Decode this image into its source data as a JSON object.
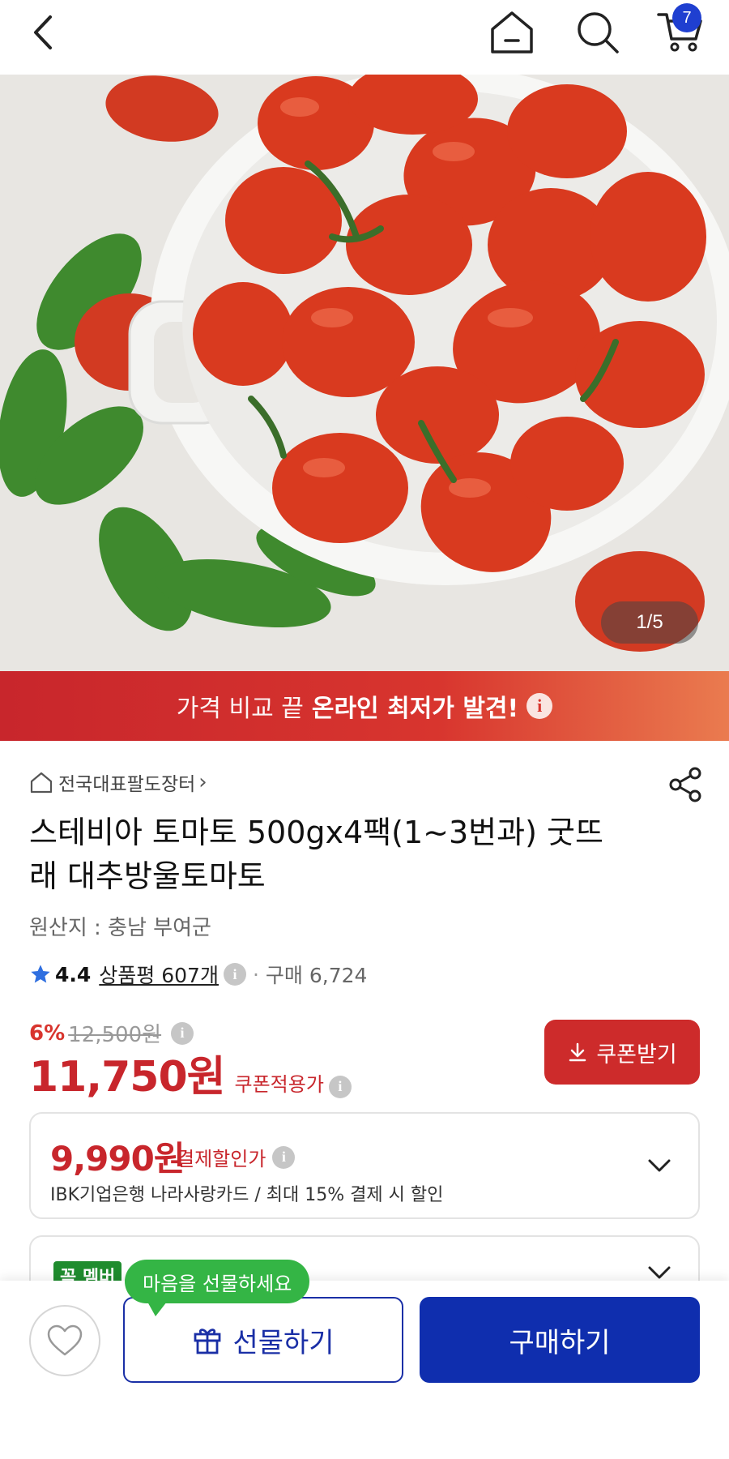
{
  "header": {
    "cart_count": "7",
    "icons": [
      "back-arrow-icon",
      "home-icon",
      "search-icon",
      "cart-icon"
    ]
  },
  "hero": {
    "counter": "1/5"
  },
  "promo": {
    "light_text": "가격 비교 끝",
    "bold_text": "온라인 최저가 발견!",
    "info_glyph": "i"
  },
  "product": {
    "store": "전국대표팔도장터",
    "title": "스테비아 토마토 500gx4팩(1~3번과) 굿뜨래 대추방울토마토",
    "origin": "원산지 : 충남 부여군",
    "rating": "4.4",
    "reviews": "상품평 607개",
    "purchases": "구매 6,724",
    "discount_pct": "6%",
    "original_price": "12,500원",
    "price": "11,750원",
    "price_label": "쿠폰적용가",
    "coupon_button": "쿠폰받기"
  },
  "payment_card": {
    "price": "9,990원",
    "label": "결제할인가",
    "desc": "IBK기업은행 나라사랑카드 / 최대 15% 결제 시 할인"
  },
  "member_card": {
    "badge": "꼭 멤버"
  },
  "bottom": {
    "tooltip": "마음을 선물하세요",
    "gift_button": "선물하기",
    "buy_button": "구매하기"
  },
  "colors": {
    "accent_red": "#c8262c",
    "primary_blue": "#0f2eae",
    "tooltip_green": "#34b545"
  }
}
